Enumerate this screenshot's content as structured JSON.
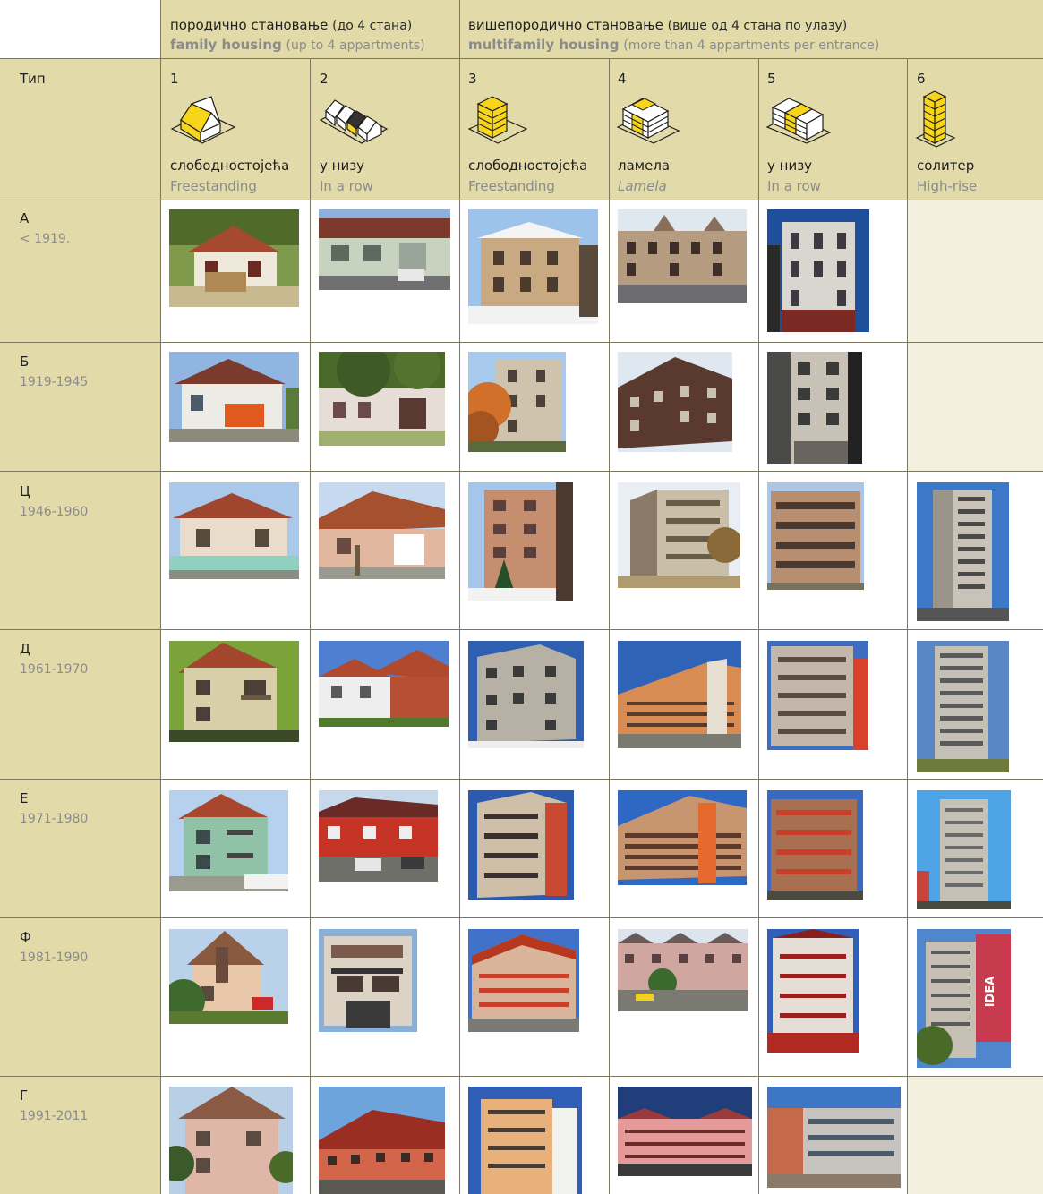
{
  "groups": {
    "family": {
      "sr": "породично становање",
      "sr_note": "(до 4 стана)",
      "en": "family housing",
      "en_note": "(up to 4 appartments)"
    },
    "multi": {
      "sr": "вишепородично становање",
      "sr_note": "(више од 4 стана по улазу)",
      "en": "multifamily housing",
      "en_note": "(more than 4 appartments per entrance)"
    }
  },
  "type_label": "Тип",
  "columns": [
    {
      "num": "1",
      "sr": "слободностојећа",
      "en": "Freestanding",
      "icon": "freestanding-house-icon"
    },
    {
      "num": "2",
      "sr": "у низу",
      "en": "In a row",
      "icon": "row-houses-icon"
    },
    {
      "num": "3",
      "sr": "слободностојећа",
      "en": "Freestanding",
      "icon": "freestanding-block-icon"
    },
    {
      "num": "4",
      "sr": "ламела",
      "en": "Lamela",
      "icon": "lamela-block-icon"
    },
    {
      "num": "5",
      "sr": "у низу",
      "en": "In a row",
      "icon": "row-blocks-icon"
    },
    {
      "num": "6",
      "sr": "солитер",
      "en": "High-rise",
      "icon": "high-rise-icon"
    }
  ],
  "rows": [
    {
      "letter": "А",
      "period": "< 1919."
    },
    {
      "letter": "Б",
      "period": "1919-1945"
    },
    {
      "letter": "Ц",
      "period": "1946-1960"
    },
    {
      "letter": "Д",
      "period": "1961-1970"
    },
    {
      "letter": "Е",
      "period": "1971-1980"
    },
    {
      "letter": "Ф",
      "period": "1981-1990"
    },
    {
      "letter": "Г",
      "period": "1991-2011"
    }
  ],
  "colors": {
    "header_tan": "#e2dba9",
    "empty_beige": "#f3f0e0",
    "icon_yellow": "#f7d51a",
    "grid_line": "#7d7862"
  },
  "photo_sign": "IDEA"
}
